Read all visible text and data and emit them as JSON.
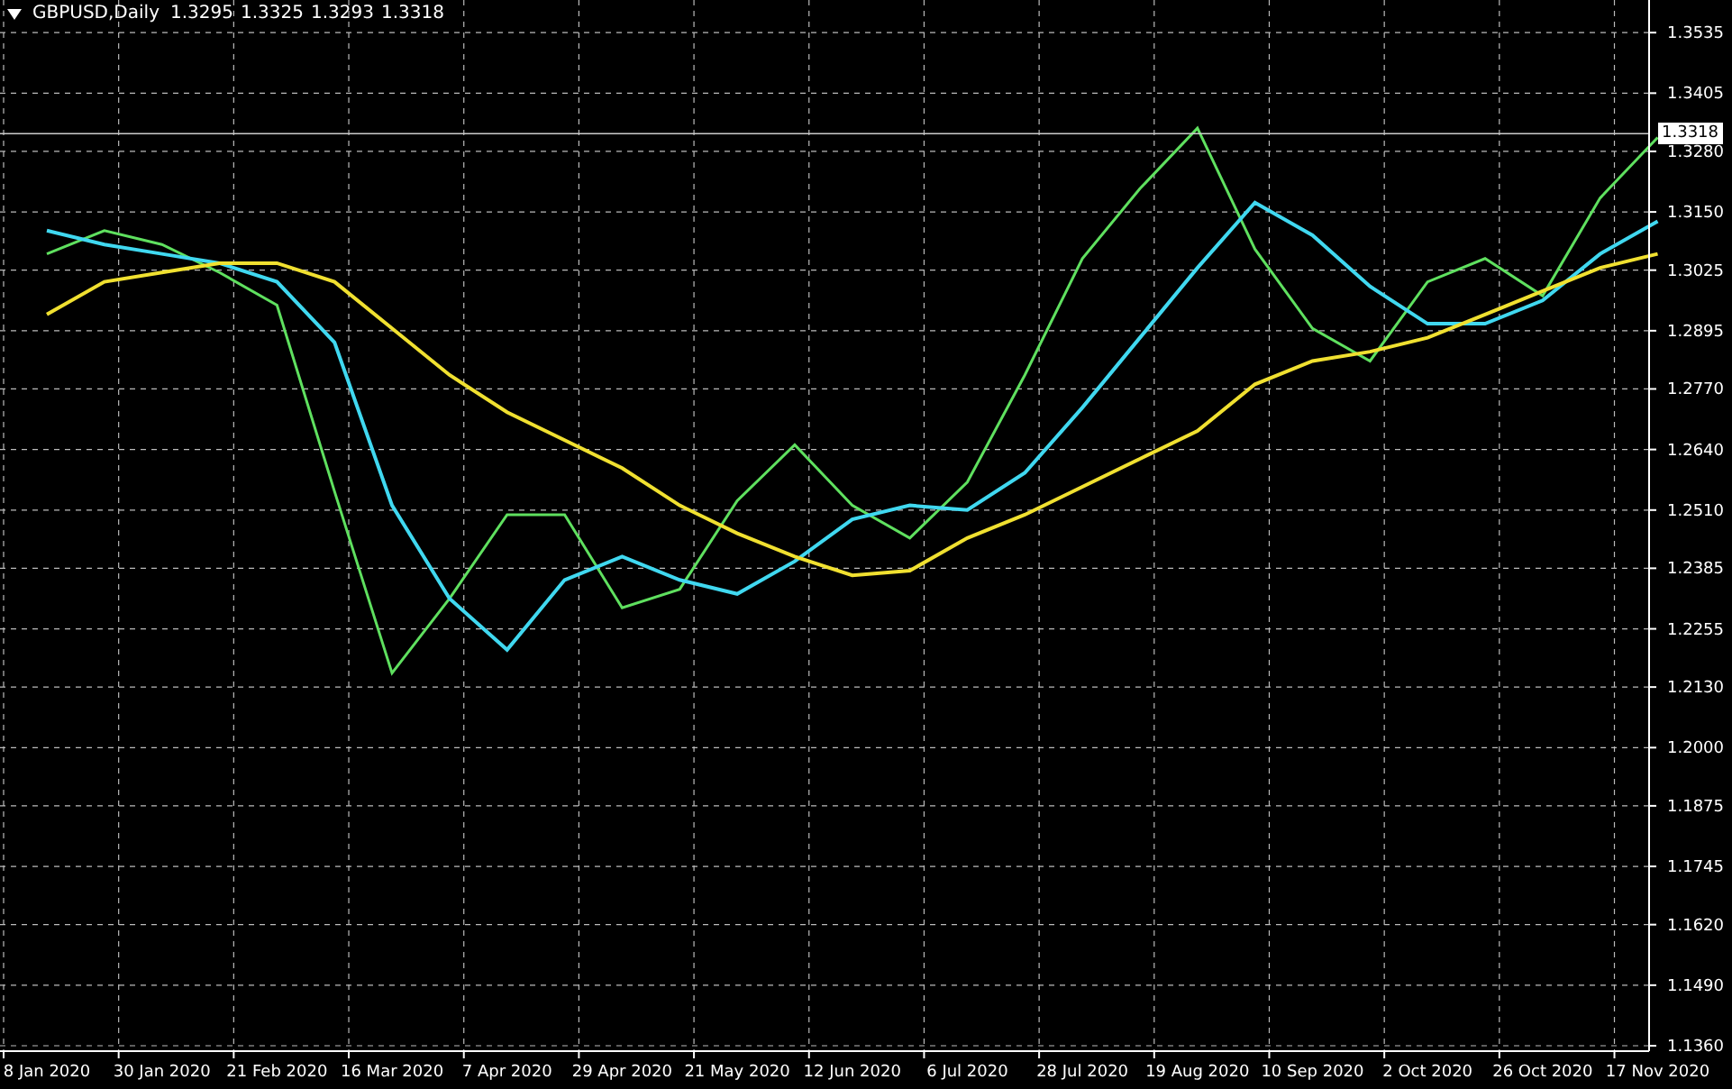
{
  "chart": {
    "title": "GBPUSD,Daily",
    "quote": [
      "1.3295",
      "1.3325",
      "1.3293",
      "1.3318"
    ],
    "current_price": "1.3318",
    "chart_data": {
      "type": "line",
      "grid": true,
      "ylim": [
        1.136,
        1.3605
      ],
      "categories": [
        "8 Jan 2020",
        null,
        "30 Jan 2020",
        null,
        "21 Feb 2020",
        null,
        "16 Mar 2020",
        null,
        "7 Apr 2020",
        null,
        "29 Apr 2020",
        null,
        "21 May 2020",
        null,
        "12 Jun 2020",
        null,
        "6 Jul 2020",
        null,
        "28 Jul 2020",
        null,
        "19 Aug 2020",
        null,
        "10 Sep 2020",
        null,
        "2 Oct 2020",
        null,
        "26 Oct 2020",
        null,
        "17 Nov 2020"
      ],
      "series": [
        {
          "color": "#5fe05f",
          "values": [
            1.306,
            1.311,
            1.308,
            1.302,
            1.295,
            1.255,
            1.216,
            1.232,
            1.25,
            1.25,
            1.23,
            1.234,
            1.253,
            1.265,
            1.252,
            1.245,
            1.257,
            1.28,
            1.305,
            1.32,
            1.333,
            1.307,
            1.29,
            1.283,
            1.3,
            1.305,
            1.297,
            1.318,
            1.331
          ]
        },
        {
          "color": "#40d8f0",
          "values": [
            1.311,
            1.308,
            1.306,
            1.304,
            1.3,
            1.287,
            1.252,
            1.232,
            1.221,
            1.236,
            1.241,
            1.236,
            1.233,
            1.24,
            1.249,
            1.252,
            1.251,
            1.259,
            1.273,
            1.288,
            1.303,
            1.317,
            1.31,
            1.299,
            1.291,
            1.291,
            1.296,
            1.306,
            1.313
          ]
        },
        {
          "color": "#f0e030",
          "values": [
            1.293,
            1.3,
            1.302,
            1.304,
            1.304,
            1.3,
            1.29,
            1.28,
            1.272,
            1.266,
            1.26,
            1.252,
            1.246,
            1.241,
            1.237,
            1.238,
            1.245,
            1.25,
            1.256,
            1.262,
            1.268,
            1.278,
            1.283,
            1.285,
            1.288,
            1.293,
            1.298,
            1.303,
            1.306
          ]
        }
      ],
      "ref_lines": [
        {
          "axis": "y",
          "value": 1.3318
        }
      ],
      "yticks": [
        {
          "value": 1.3535,
          "label": "1.3535"
        },
        {
          "value": 1.3405,
          "label": "1.3405"
        },
        {
          "value": 1.328,
          "label": "1.3280"
        },
        {
          "value": 1.315,
          "label": "1.3150"
        },
        {
          "value": 1.3025,
          "label": "1.3025"
        },
        {
          "value": 1.2895,
          "label": "1.2895"
        },
        {
          "value": 1.277,
          "label": "1.2770"
        },
        {
          "value": 1.264,
          "label": "1.2640"
        },
        {
          "value": 1.251,
          "label": "1.2510"
        },
        {
          "value": 1.2385,
          "label": "1.2385"
        },
        {
          "value": 1.2255,
          "label": "1.2255"
        },
        {
          "value": 1.213,
          "label": "1.2130"
        },
        {
          "value": 1.2,
          "label": "1.2000"
        },
        {
          "value": 1.1875,
          "label": "1.1875"
        },
        {
          "value": 1.1745,
          "label": "1.1745"
        },
        {
          "value": 1.162,
          "label": "1.1620"
        },
        {
          "value": 1.149,
          "label": "1.1490"
        },
        {
          "value": 1.136,
          "label": "1.1360"
        }
      ]
    }
  }
}
